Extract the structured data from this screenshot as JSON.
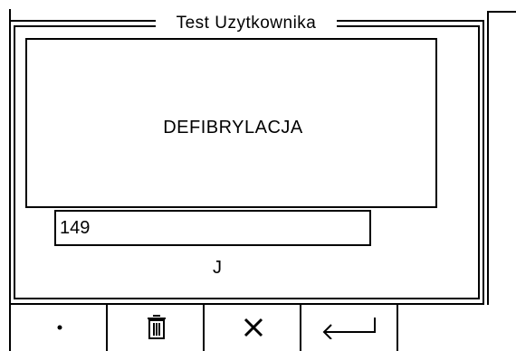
{
  "dialog": {
    "title": "Test Uzytkownika",
    "message": "DEFIBRYLACJA",
    "value": "149",
    "unit": "J"
  },
  "softkeys": [
    {
      "label": "•",
      "icon": "dot-icon"
    },
    {
      "label": "🗑",
      "icon": "trash-icon"
    },
    {
      "label": "×",
      "icon": "close-icon"
    },
    {
      "label": "↵",
      "icon": "enter-arrow-icon"
    }
  ]
}
